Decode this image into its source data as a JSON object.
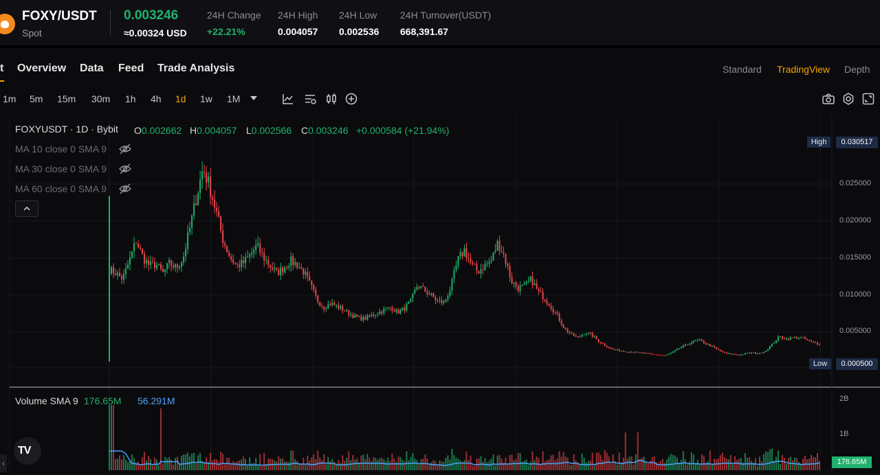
{
  "header": {
    "pair": "FOXY/USDT",
    "market": "Spot",
    "price": "0.003246",
    "price_usd": "≈0.00324 USD",
    "stats": [
      {
        "label": "24H Change",
        "value": "+22.21%",
        "color": "#20b26c"
      },
      {
        "label": "24H High",
        "value": "0.004057",
        "color": "#ffffff"
      },
      {
        "label": "24H Low",
        "value": "0.002536",
        "color": "#ffffff"
      },
      {
        "label": "24H Turnover(USDT)",
        "value": "668,391.67",
        "color": "#ffffff"
      }
    ]
  },
  "tabs": [
    "t",
    "Overview",
    "Data",
    "Feed",
    "Trade Analysis"
  ],
  "views": [
    {
      "label": "Standard",
      "active": false
    },
    {
      "label": "TradingView",
      "active": true
    },
    {
      "label": "Depth",
      "active": false
    }
  ],
  "timeframes": [
    {
      "label": "1m",
      "active": false
    },
    {
      "label": "5m",
      "active": false
    },
    {
      "label": "15m",
      "active": false
    },
    {
      "label": "30m",
      "active": false
    },
    {
      "label": "1h",
      "active": false
    },
    {
      "label": "4h",
      "active": false
    },
    {
      "label": "1d",
      "active": true
    },
    {
      "label": "1w",
      "active": false
    },
    {
      "label": "1M",
      "active": false
    }
  ],
  "chart_legend": {
    "title": "FOXYUSDT · 1D · Bybit",
    "o_label": "O",
    "o": "0.002662",
    "h_label": "H",
    "h": "0.004057",
    "l_label": "L",
    "l": "0.002566",
    "c_label": "C",
    "c": "0.003246",
    "change": "+0.000584 (+21.94%)"
  },
  "indicators": [
    "MA 10 close 0 SMA 9",
    "MA 30 close 0 SMA 9",
    "MA 60 close 0 SMA 9"
  ],
  "price_axis": {
    "high_tag": "High",
    "high_value": "0.030517",
    "low_tag": "Low",
    "low_value": "0.000500",
    "ticks": [
      "0.025000",
      "0.020000",
      "0.015000",
      "0.010000",
      "0.005000"
    ]
  },
  "volume": {
    "title": "Volume SMA 9",
    "value": "176.65M",
    "sma": "56.291M",
    "axis_ticks": [
      "2B",
      "1B"
    ],
    "current_tag": "176.65M"
  },
  "colors": {
    "up": "#20b26c",
    "down": "#ef454a",
    "accent": "#f7a600",
    "sma": "#4aa3ff"
  },
  "chart_data": {
    "type": "candlestick",
    "interval": "1D",
    "y_axis_range": [
      0.0005,
      0.030517
    ],
    "close_trend": [
      0.0133,
      0.0128,
      0.012,
      0.0145,
      0.0172,
      0.015,
      0.0138,
      0.014,
      0.0128,
      0.0142,
      0.0135,
      0.0148,
      0.0188,
      0.0232,
      0.0271,
      0.0245,
      0.021,
      0.0172,
      0.015,
      0.0138,
      0.0142,
      0.0152,
      0.0165,
      0.015,
      0.0138,
      0.0128,
      0.0135,
      0.0145,
      0.014,
      0.013,
      0.0112,
      0.0092,
      0.0082,
      0.0087,
      0.0083,
      0.0078,
      0.0072,
      0.0068,
      0.0066,
      0.007,
      0.0074,
      0.0078,
      0.0082,
      0.0075,
      0.008,
      0.009,
      0.0112,
      0.0105,
      0.0098,
      0.009,
      0.0088,
      0.011,
      0.0145,
      0.016,
      0.014,
      0.013,
      0.0138,
      0.0145,
      0.017,
      0.015,
      0.0118,
      0.0108,
      0.011,
      0.012,
      0.0102,
      0.0094,
      0.0082,
      0.0068,
      0.0052,
      0.0045,
      0.004,
      0.0048,
      0.0044,
      0.0036,
      0.003,
      0.0025,
      0.0023,
      0.0022,
      0.0021,
      0.002,
      0.0019,
      0.0018,
      0.0017,
      0.0016,
      0.002,
      0.0026,
      0.003,
      0.0035,
      0.0037,
      0.0033,
      0.0028,
      0.0023,
      0.0019,
      0.0018,
      0.0017,
      0.0019,
      0.002,
      0.0019,
      0.0023,
      0.0032,
      0.0042,
      0.0039,
      0.004,
      0.0041,
      0.0038,
      0.0034,
      0.0032
    ]
  }
}
